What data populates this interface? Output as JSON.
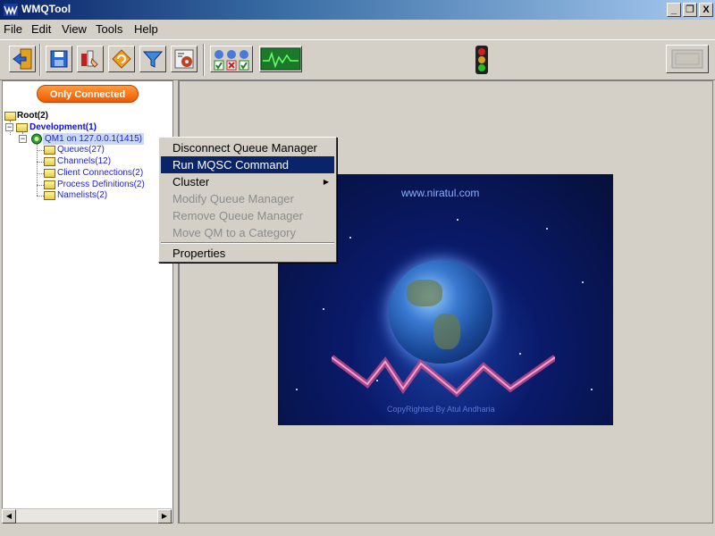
{
  "window": {
    "title": "WMQTool",
    "minimize": "_",
    "restore": "❐",
    "close": "X"
  },
  "menubar": {
    "items": [
      "File",
      "Edit",
      "View",
      "Tools",
      "Help"
    ]
  },
  "toolbar": {
    "buttons": [
      "exit-icon",
      "save-icon",
      "manage-icon",
      "refresh-icon",
      "filter-icon",
      "settings-icon",
      "queue-status-icon",
      "monitor-icon"
    ],
    "status_light": "traffic-light-icon",
    "right_button": "panel-icon"
  },
  "left_panel": {
    "filter_button": "Only Connected",
    "tree": {
      "root": "Root(2)",
      "category": "Development(1)",
      "queue_manager": "QM1  on 127.0.0.1(1415)",
      "children": [
        "Queues(27)",
        "Channels(12)",
        "Client Connections(2)",
        "Process Definitions(2)",
        "Namelists(2)"
      ]
    }
  },
  "context_menu": {
    "items": [
      {
        "label": "Disconnect Queue Manager",
        "state": "enabled"
      },
      {
        "label": "Run MQSC Command",
        "state": "selected"
      },
      {
        "label": "Cluster",
        "state": "enabled",
        "submenu": true
      },
      {
        "label": "Modify Queue Manager",
        "state": "disabled"
      },
      {
        "label": "Remove Queue Manager",
        "state": "disabled"
      },
      {
        "label": "Move QM to a Category",
        "state": "disabled"
      },
      {
        "label": "Properties",
        "state": "enabled"
      }
    ]
  },
  "splash": {
    "url": "www.niratul.com",
    "copyright": "CopyRighted By Atul Andharia"
  },
  "colors": {
    "selection": "#0a246a",
    "accent": "#f05a00",
    "tree_text": "#2222cc"
  }
}
